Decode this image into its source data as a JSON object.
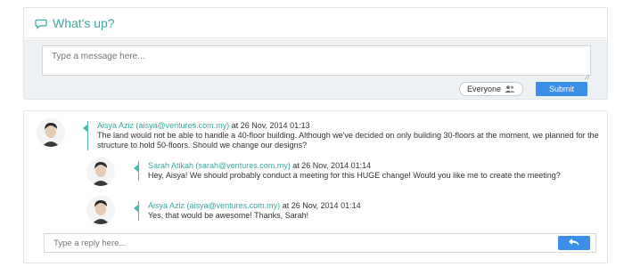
{
  "whats_up": {
    "title": "What's up?",
    "message_placeholder": "Type a message here...",
    "audience_label": "Everyone",
    "submit_label": "Submit"
  },
  "feed": {
    "post": {
      "author": "Aisya Aziz (aisya@ventures.com.my)",
      "date_text": " at 26 Nov, 2014 01:13",
      "body": "The land would not be able to handle a 40-floor building. Although we've decided on only building 30-floors at the moment, we planned for the structure to hold 50-floors. Should we change our designs?"
    },
    "replies": [
      {
        "author": "Sarah Atikah (sarah@ventures.com.my)",
        "date_text": " at 26 Nov, 2014 01:14",
        "body": "Hey, Aisya! We should probably conduct a meeting for this HUGE change! Would you like me to create the meeting?"
      },
      {
        "author": "Aisya Aziz (aisya@ventures.com.my)",
        "date_text": " at 26 Nov, 2014 01:14",
        "body": "Yes, that would be awesome! Thanks, Sarah!"
      }
    ],
    "reply_placeholder": "Type a reply here..."
  },
  "colors": {
    "accent_teal": "#3aa99f",
    "button_blue": "#3b8fe8",
    "compose_bg": "#eef1f4"
  },
  "icons": {
    "header": "chat-bubble-icon",
    "audience": "people-icon",
    "reply": "reply-arrow-icon"
  }
}
